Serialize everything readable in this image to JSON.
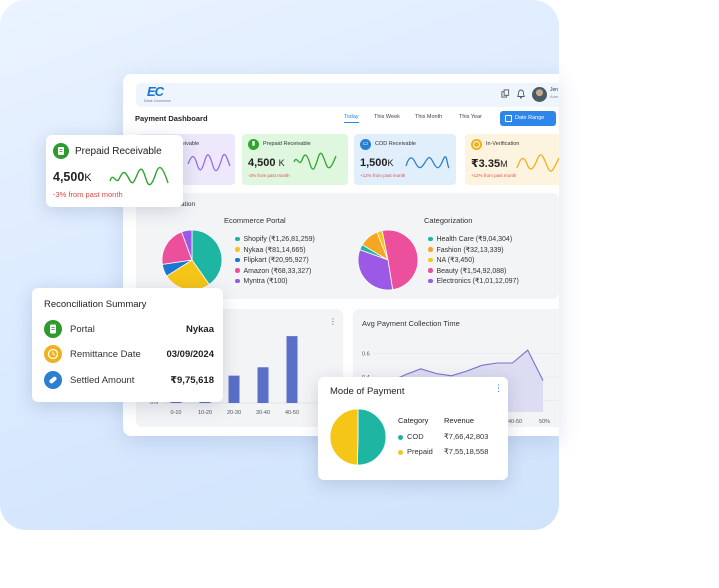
{
  "brand": {
    "logo_text": "EC",
    "logo_sub": "Easie Commerce"
  },
  "header": {
    "user_name": "Jen",
    "user_role": "Adm"
  },
  "dashboard": {
    "title": "Payment Dashboard",
    "periods": [
      "Today",
      "This Week",
      "This Month",
      "This Year"
    ],
    "active_period": "Today",
    "date_range_label": "Date Range"
  },
  "kpis": [
    {
      "label": "eceivable",
      "value": "",
      "value_unit": "",
      "change": "",
      "color": "#ede8fb",
      "accent": "#9b6bde"
    },
    {
      "label": "Prepaid Receivable",
      "value": "4,500",
      "value_unit": "K",
      "change": "-3% from past month",
      "color": "#dff7df",
      "accent": "#2fa52f"
    },
    {
      "label": "COD Receivable",
      "value": "1,500",
      "value_unit": "K",
      "change": "+12% from past month",
      "color": "#e1eefb",
      "accent": "#2a7fd0"
    },
    {
      "label": "In-Verification",
      "value": "₹3.35",
      "value_unit": "M",
      "change": "+12% from past month",
      "color": "#fdf4e0",
      "accent": "#f2b01e"
    }
  ],
  "source": {
    "title": "urcation",
    "ecommerce_title": "Ecommerce Portal",
    "ecommerce_items": [
      {
        "label": "Shopify (₹1,26,81,259)",
        "color": "#1fb5a3"
      },
      {
        "label": "Nykaa (₹81,14,665)",
        "color": "#f5c518"
      },
      {
        "label": "Flipkart (₹20,95,927)",
        "color": "#1976d2"
      },
      {
        "label": "Amazon (₹68,33,327)",
        "color": "#ec4f9b"
      },
      {
        "label": "Myntra (₹100)",
        "color": "#9b59e6"
      }
    ],
    "category_title": "Categorization",
    "category_items": [
      {
        "label": "Health Care  (₹9,04,304)",
        "color": "#1fb5a3"
      },
      {
        "label": "Fashion (₹32,13,339)",
        "color": "#f5a623"
      },
      {
        "label": "NA (₹3,450)",
        "color": "#f5c518"
      },
      {
        "label": "Beauty (₹1,54,92,088)",
        "color": "#ec4f9b"
      },
      {
        "label": "Electronics (₹1,01,12,097)",
        "color": "#9b59e6"
      }
    ]
  },
  "bar_panel": {
    "kebab": "⋮",
    "y_tick": "0%",
    "x_ticks": [
      "0-10",
      "10-20",
      "20-30",
      "30-40",
      "40-50"
    ]
  },
  "line_panel": {
    "title": "Avg Payment Collection Time",
    "y_ticks": [
      "0.6",
      "0.4",
      "0.2"
    ],
    "x_ticks": [
      "40-50",
      "50%"
    ]
  },
  "prepaid_card": {
    "title": "Prepaid Receivable",
    "value": "4,500",
    "unit": "K",
    "change": "-3% from past month"
  },
  "reconciliation": {
    "title": "Reconciliation Summary",
    "rows": [
      {
        "label": "Portal",
        "value": "Nykaa",
        "color": "#2e9a2e",
        "icon": "document-icon"
      },
      {
        "label": "Remittance Date",
        "value": "03/09/2024",
        "color": "#f2b01e",
        "icon": "clock-icon"
      },
      {
        "label": "Settled Amount",
        "value": "₹9,75,618",
        "color": "#2a7fd0",
        "icon": "tag-icon"
      }
    ]
  },
  "mode_of_payment": {
    "title": "Mode of Payment",
    "kebab": "⋮",
    "col_category": "Category",
    "col_revenue": "Revenue",
    "rows": [
      {
        "category": "COD",
        "revenue": "₹7,66,42,803",
        "color": "#1fb5a3"
      },
      {
        "category": "Prepaid",
        "revenue": "₹7,55,18,558",
        "color": "#f5c518"
      }
    ]
  },
  "chart_data": [
    {
      "type": "pie",
      "title": "Ecommerce Portal",
      "categories": [
        "Shopify",
        "Nykaa",
        "Flipkart",
        "Amazon",
        "Myntra"
      ],
      "values": [
        12681259,
        8114665,
        2095927,
        6833327,
        100
      ]
    },
    {
      "type": "pie",
      "title": "Categorization",
      "categories": [
        "Health Care",
        "Fashion",
        "NA",
        "Beauty",
        "Electronics"
      ],
      "values": [
        904304,
        3213339,
        3450,
        15492088,
        10112097
      ]
    },
    {
      "type": "bar",
      "categories": [
        "0-10",
        "10-20",
        "20-30",
        "30-40",
        "40-50"
      ],
      "values": [
        0.3,
        0.45,
        0.36,
        0.47,
        0.88
      ],
      "ylim": [
        0,
        1
      ]
    },
    {
      "type": "area",
      "title": "Avg Payment Collection Time",
      "values": [
        0.3,
        0.36,
        0.42,
        0.47,
        0.43,
        0.41,
        0.45,
        0.5,
        0.52,
        0.52,
        0.63,
        0.37
      ],
      "ylim": [
        0.1,
        0.7
      ]
    },
    {
      "type": "pie",
      "title": "Mode of Payment",
      "categories": [
        "COD",
        "Prepaid"
      ],
      "values": [
        76642803,
        75518558
      ]
    }
  ]
}
